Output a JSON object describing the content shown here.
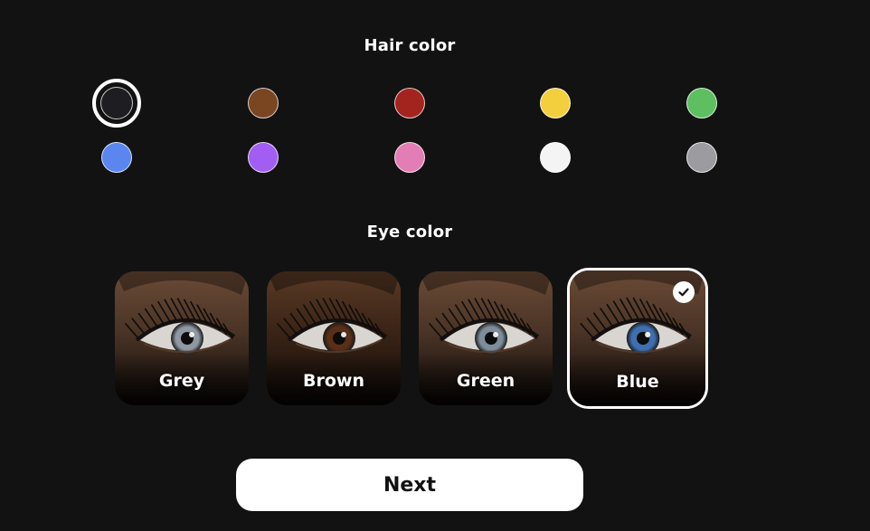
{
  "hair_color": {
    "title": "Hair color",
    "selected": "black",
    "swatches": [
      {
        "id": "black",
        "color": "#1e1e22"
      },
      {
        "id": "brown",
        "color": "#7a4521"
      },
      {
        "id": "red",
        "color": "#a3241f"
      },
      {
        "id": "yellow",
        "color": "#f3cf3e"
      },
      {
        "id": "green",
        "color": "#5dbf5f"
      },
      {
        "id": "blue",
        "color": "#5b86f0"
      },
      {
        "id": "purple",
        "color": "#a25ef3"
      },
      {
        "id": "pink",
        "color": "#e37db5"
      },
      {
        "id": "white",
        "color": "#f4f4f4"
      },
      {
        "id": "grey",
        "color": "#9c9ca0"
      }
    ]
  },
  "eye_color": {
    "title": "Eye color",
    "selected": "Blue",
    "options": [
      {
        "label": "Grey",
        "iris": "#8f98a3"
      },
      {
        "label": "Brown",
        "iris": "#5a2f18"
      },
      {
        "label": "Green",
        "iris": "#7e8d9a"
      },
      {
        "label": "Blue",
        "iris": "#3e6fb0"
      }
    ]
  },
  "next_button": {
    "label": "Next"
  },
  "colors": {
    "background": "#121212",
    "accent": "#ffffff"
  }
}
